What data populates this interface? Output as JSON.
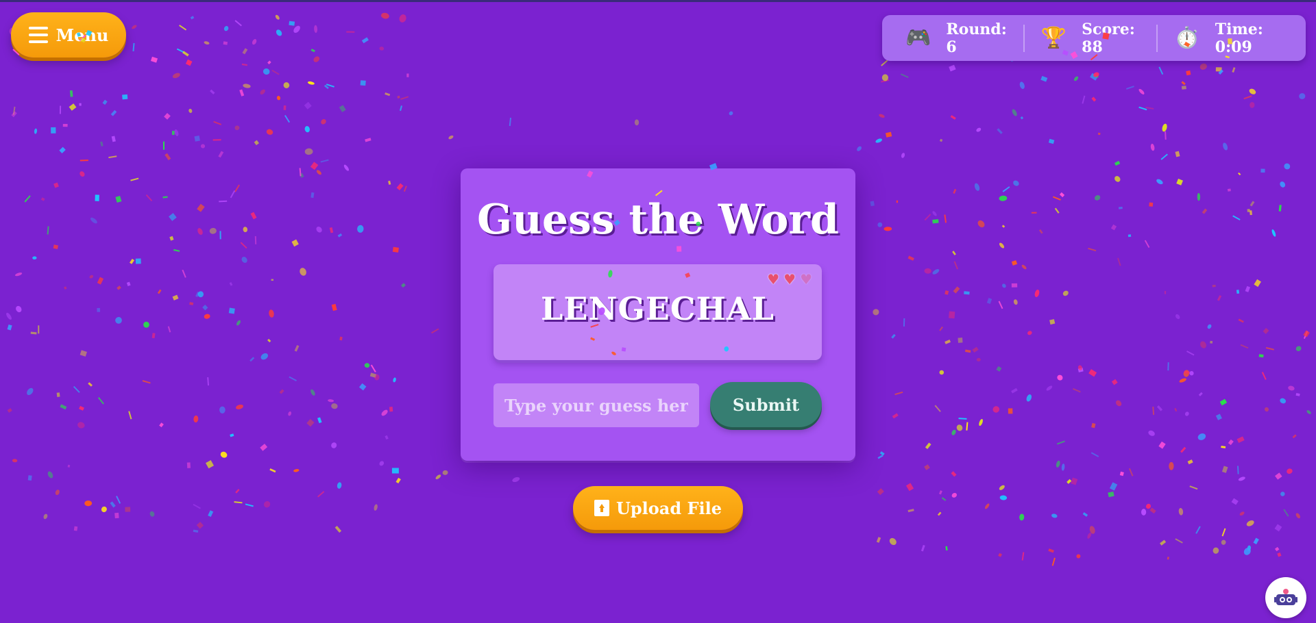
{
  "menu": {
    "label": "Menu",
    "icon": "hamburger-icon"
  },
  "stats": {
    "round": {
      "icon": "🎮",
      "label": "Round: 6"
    },
    "score": {
      "icon": "🏆",
      "label": "Score: 88"
    },
    "time": {
      "icon": "⏱️",
      "label": "Time: 0:09"
    }
  },
  "game": {
    "title": "Guess the Word",
    "scrambled_word": "LENGECHAL",
    "lives": {
      "total": 3,
      "remaining": 2
    },
    "guess_placeholder": "Type your guess here...",
    "guess_value": "",
    "submit_label": "Submit"
  },
  "upload": {
    "label": "Upload File",
    "icon": "file-upload-icon"
  },
  "assistant": {
    "icon": "robot-assistant-icon"
  },
  "colors": {
    "background": "#7b22d0",
    "card": "#a453f2",
    "accent_orange": "#f59a0a",
    "submit_green": "#367e72"
  }
}
